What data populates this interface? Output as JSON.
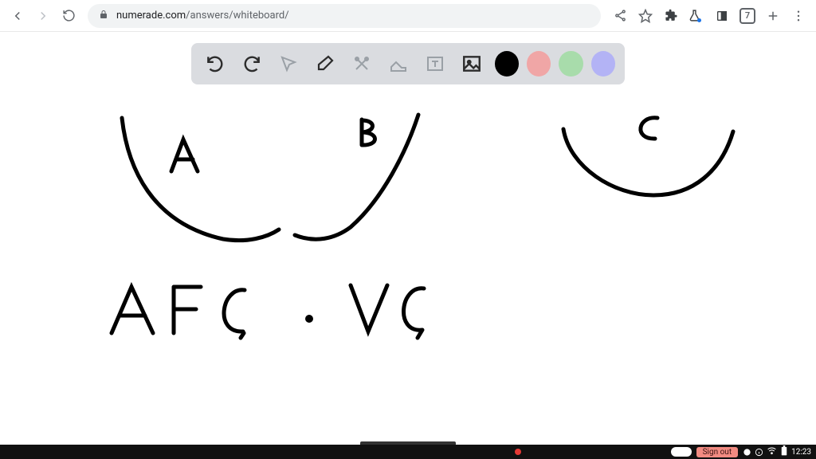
{
  "chrome": {
    "url_domain": "numerade.com",
    "url_path": "/answers/whiteboard/",
    "tab_count": "7"
  },
  "toolbar": {
    "colors": {
      "black": "#000000",
      "red": "#f0a6a6",
      "green": "#a8dcab",
      "purple": "#b3b3f5"
    }
  },
  "whiteboard": {
    "labels": {
      "A": "A",
      "B": "B",
      "C": "C",
      "AFC": "AFC",
      "dot": ".",
      "VC": "VC"
    }
  },
  "shelf": {
    "signout_label": "Sign out",
    "clock": "12:23"
  }
}
